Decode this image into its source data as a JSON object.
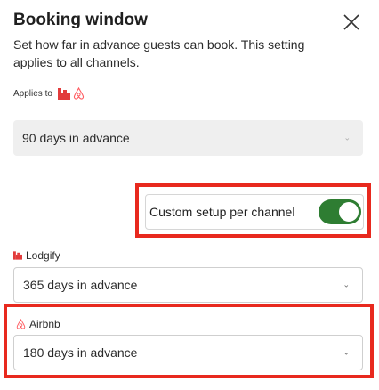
{
  "dialog": {
    "title": "Booking window",
    "subtitle": "Set how far in advance guests can book. This setting applies to all channels."
  },
  "applies_to": {
    "label": "Applies to",
    "icons": [
      "lodgify-icon",
      "airbnb-icon"
    ]
  },
  "global_select": {
    "value": "90 days in advance"
  },
  "custom_setup": {
    "label": "Custom setup per channel",
    "enabled": true
  },
  "channels": [
    {
      "name": "Lodgify",
      "icon": "lodgify-icon",
      "value": "365 days in advance"
    },
    {
      "name": "Airbnb",
      "icon": "airbnb-icon",
      "value": "180 days in advance"
    }
  ],
  "colors": {
    "highlight": "#e8291e",
    "toggle_on": "#2e7d32",
    "lodgify_brand": "#e23b3b",
    "airbnb_brand": "#ff5a5f"
  }
}
